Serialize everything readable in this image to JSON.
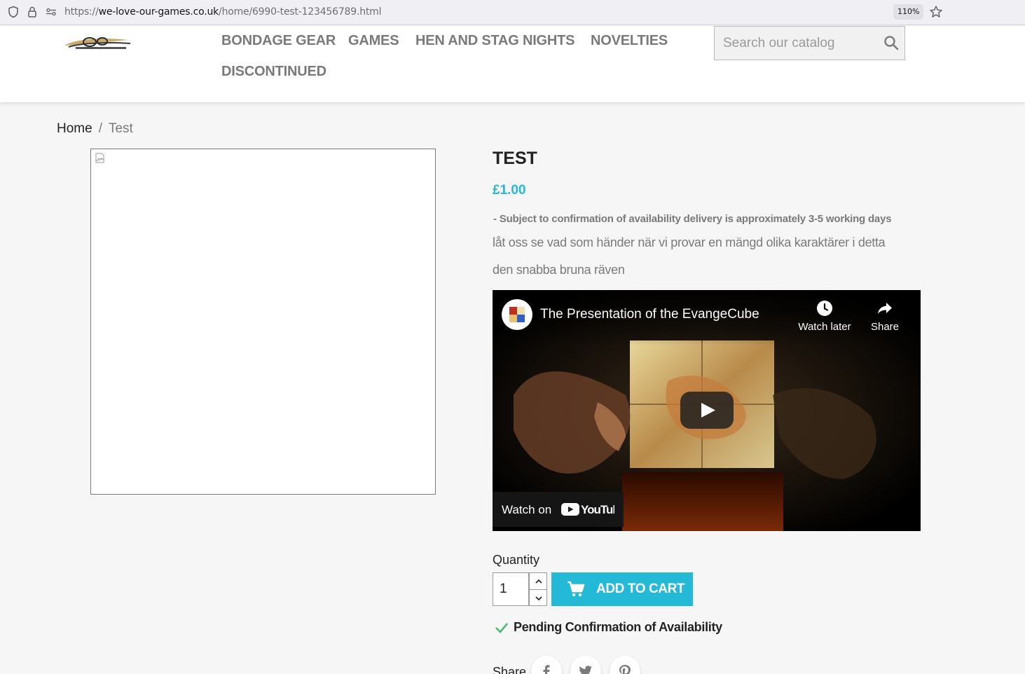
{
  "browser": {
    "url_prefix": "https://",
    "url_host": "we-love-our-games.co.uk",
    "url_path": "/home/6990-test-123456789.html",
    "zoom": "110%"
  },
  "header": {
    "logo_alt": "WE LOVE OUR GAMES",
    "nav": [
      "BONDAGE GEAR",
      "GAMES",
      "HEN AND STAG NIGHTS",
      "NOVELTIES",
      "DISCONTINUED"
    ],
    "search_placeholder": "Search our catalog"
  },
  "breadcrumb": {
    "home": "Home",
    "current": "Test"
  },
  "product": {
    "title": "TEST",
    "price": "£1.00",
    "availability_note": "- Subject to confirmation of availability delivery is approximately 3-5 working days",
    "description_lines": [
      "låt oss se vad som händer när vi provar en mängd olika karaktärer i detta",
      "den snabba bruna räven"
    ],
    "quantity_label": "Quantity",
    "quantity_value": "1",
    "add_to_cart": "ADD TO CART",
    "availability_status": "Pending Confirmation of Availability",
    "share_label": "Share"
  },
  "video": {
    "title": "The Presentation of the EvangeCube",
    "watch_later": "Watch later",
    "share": "Share",
    "watch_on": "Watch on",
    "youtube": "YouTube"
  },
  "colors": {
    "accent": "#24b9d7",
    "text_dark": "#232323",
    "text_muted": "#7a7a7a",
    "success": "#4cbb6c"
  }
}
